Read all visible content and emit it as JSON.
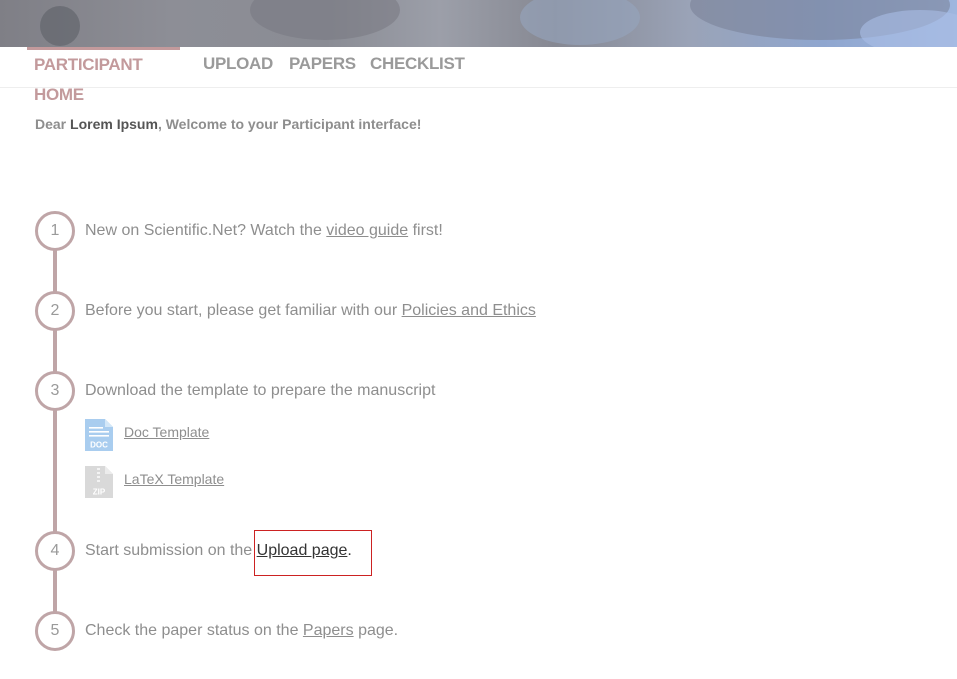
{
  "nav": {
    "tabs": [
      {
        "label": "PARTICIPANT HOME",
        "active": true
      },
      {
        "label": "UPLOAD",
        "active": false
      },
      {
        "label": "PAPERS",
        "active": false
      },
      {
        "label": "CHECKLIST",
        "active": false
      }
    ]
  },
  "welcome": {
    "prefix": "Dear ",
    "name": "Lorem Ipsum",
    "suffix": ", Welcome to your Participant interface!"
  },
  "steps": [
    {
      "number": "1",
      "text_before": "New on Scientific.Net? Watch the ",
      "link": "video guide",
      "text_after": " first!"
    },
    {
      "number": "2",
      "text_before": "Before you start, please get familiar with our ",
      "link": "Policies and Ethics",
      "text_after": ""
    },
    {
      "number": "3",
      "text_before": "Download the template to prepare the manuscript",
      "link": "",
      "text_after": ""
    },
    {
      "number": "4",
      "text_before": "Start submission on the ",
      "link": "Upload page",
      "text_after": "."
    },
    {
      "number": "5",
      "text_before": "Check the paper status on the ",
      "link": "Papers",
      "text_after": " page."
    }
  ],
  "files": [
    {
      "icon": "doc-file-icon",
      "label": "Doc Template",
      "badge": "DOC"
    },
    {
      "icon": "zip-file-icon",
      "label": "LaTeX Template",
      "badge": "ZIP"
    }
  ],
  "colors": {
    "accent": "#c39a9c",
    "timeline": "#bfa5a7",
    "highlight": "#cc2222"
  }
}
